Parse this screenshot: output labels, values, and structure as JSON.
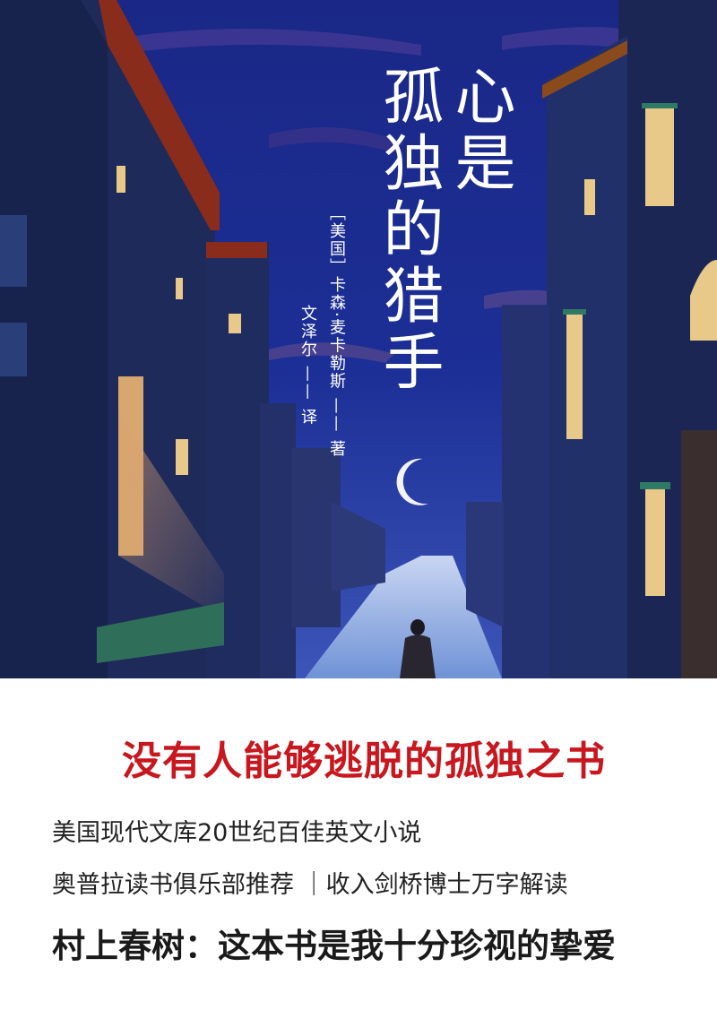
{
  "cover": {
    "title_col_1": "心是",
    "title_col_2": "孤独的猎手",
    "author": "［美国］卡森·麦卡勒斯 —— 著",
    "translator": "文泽尔 —— 译"
  },
  "blurb": {
    "tagline": "没有人能够逃脱的孤独之书",
    "line_1": "美国现代文库20世纪百佳英文小说",
    "line_2": "奥普拉读书俱乐部推荐 ｜收入剑桥博士万字解读",
    "line_3": "村上春树：这本书是我十分珍视的挚爱"
  },
  "colors": {
    "sky": "#1a2a8a",
    "accent_red": "#c8171e",
    "window_light": "#e9c98a"
  }
}
